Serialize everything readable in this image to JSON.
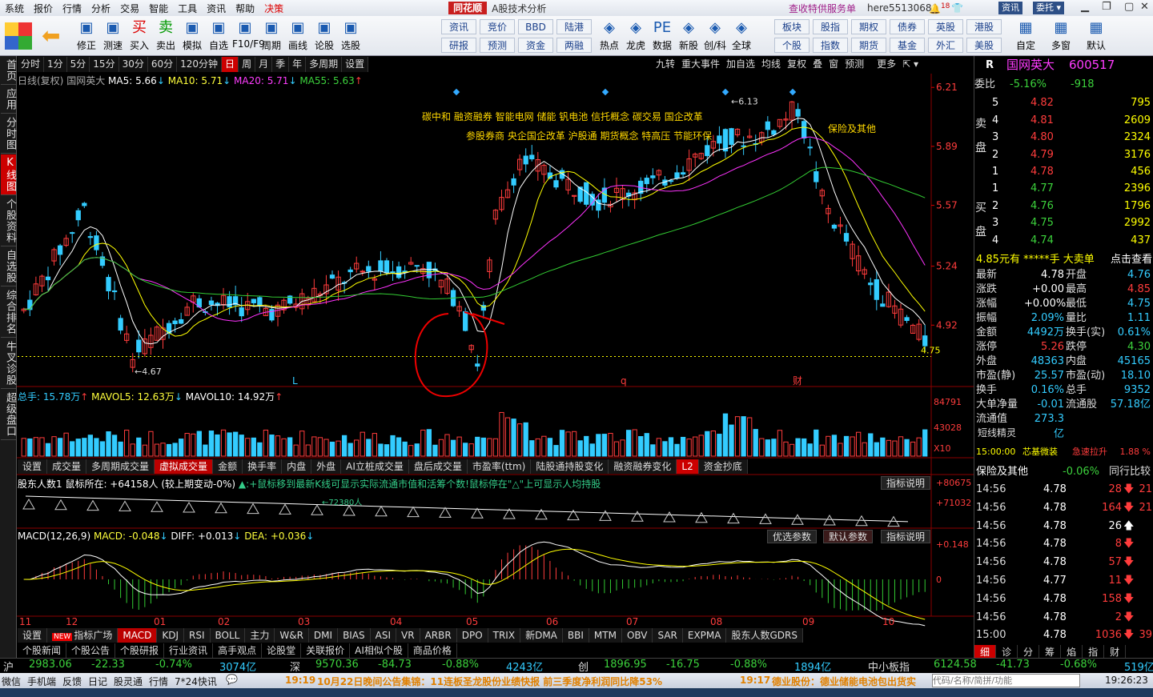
{
  "menubar": {
    "items": [
      "系统",
      "报价",
      "行情",
      "分析",
      "交易",
      "智能",
      "工具",
      "资讯",
      "帮助"
    ],
    "decision": "决策",
    "brand": "同花顺",
    "app_title": "A股技术分析",
    "promo": "查收特供服务单",
    "user": "here5513068",
    "bell_badge": "18",
    "btn_news": "资讯",
    "btn_entrust": "委托"
  },
  "toolbar": {
    "buttons": [
      {
        "label": "修正",
        "icon": "up-down-arrows-icon"
      },
      {
        "label": "测速",
        "icon": "speed-icon"
      },
      {
        "label": "买入",
        "icon": "buy-icon",
        "glyph": "买"
      },
      {
        "label": "卖出",
        "icon": "sell-icon",
        "glyph": "卖"
      },
      {
        "label": "模拟",
        "icon": "hammer-icon"
      },
      {
        "label": "自选",
        "icon": "star-icon"
      },
      {
        "label": "F10/F9",
        "icon": "f10-icon"
      },
      {
        "label": "周期",
        "icon": "clock-icon"
      },
      {
        "label": "画线",
        "icon": "pencil-icon"
      },
      {
        "label": "论股",
        "icon": "comment-icon"
      },
      {
        "label": "选股",
        "icon": "magnifier-icon"
      }
    ],
    "grid": [
      [
        "资讯",
        "竞价",
        "BBD",
        "陆港"
      ],
      [
        "研报",
        "预测",
        "资金",
        "两融"
      ]
    ],
    "buttons2": [
      {
        "label": "热点",
        "icon": "fire-icon"
      },
      {
        "label": "龙虎",
        "icon": "tiger-icon"
      },
      {
        "label": "数据",
        "icon": "pe-icon",
        "glyph": "PE"
      },
      {
        "label": "新股",
        "icon": "building-icon"
      },
      {
        "label": "创/科",
        "icon": "chuang-icon"
      },
      {
        "label": "全球",
        "icon": "globe-icon"
      }
    ],
    "grid2": [
      [
        "板块",
        "股指",
        "期权",
        "债券",
        "英股",
        "港股"
      ],
      [
        "个股",
        "指数",
        "期货",
        "基金",
        "外汇",
        "美股"
      ]
    ],
    "buttons3": [
      {
        "label": "自定",
        "icon": "custom-icon"
      },
      {
        "label": "多窗",
        "icon": "windows-icon"
      },
      {
        "label": "默认",
        "icon": "home-icon"
      }
    ]
  },
  "left_tabs": [
    {
      "label": "首页",
      "sel": false
    },
    {
      "label": "应用",
      "sel": false
    },
    {
      "label": "分时图",
      "sel": false
    },
    {
      "label": "K线图",
      "sel": true
    },
    {
      "label": "个股资料",
      "sel": false
    },
    {
      "label": "自选股",
      "sel": false
    },
    {
      "label": "综合排名",
      "sel": false
    },
    {
      "label": "牛叉诊股",
      "sel": false
    },
    {
      "label": "超级盘口",
      "sel": false
    }
  ],
  "period_tabs": [
    {
      "label": "分时"
    },
    {
      "label": "1分"
    },
    {
      "label": "5分"
    },
    {
      "label": "15分"
    },
    {
      "label": "30分"
    },
    {
      "label": "60分"
    },
    {
      "label": "120分钟"
    },
    {
      "label": "日",
      "sel": true
    },
    {
      "label": "周"
    },
    {
      "label": "月"
    },
    {
      "label": "季"
    },
    {
      "label": "年"
    },
    {
      "label": "多周期"
    },
    {
      "label": "设置"
    }
  ],
  "right_tabs": [
    "九转",
    "重大事件",
    "加自选",
    "均线",
    "复权",
    "叠",
    "窗",
    "预测",
    "",
    "更多"
  ],
  "ma_line": {
    "prefix": "日线(复权)",
    "name": "国网英大",
    "ma5": "MA5: 5.66",
    "ma10": "MA10: 5.71",
    "ma20": "MA20: 5.71",
    "ma55": "MA55: 5.63"
  },
  "chart_data": {
    "type": "candlestick",
    "title": "日线(复权) 国网英大",
    "ylim": [
      4.6,
      6.25
    ],
    "y_ticks": [
      "6.21",
      "5.89",
      "5.57",
      "5.24",
      "4.92"
    ],
    "x_ticks": [
      "11",
      "12",
      "01",
      "02",
      "03",
      "04",
      "05",
      "06",
      "07",
      "08",
      "09",
      "10"
    ],
    "high": "6.13",
    "low": "4.67",
    "last": "4.75",
    "concepts_row1": "碳中和 融资融券 智能电网 储能 钒电池 信托概念 碳交易 国企改革",
    "concepts_row2": "参股券商 央企国企改革 沪股通 期货概念 特高压 节能环保",
    "insurance": "保险及其他",
    "markers": [
      {
        "label": "L"
      },
      {
        "label": "q"
      },
      {
        "label": "财"
      }
    ]
  },
  "volume": {
    "header_total": "总手: 15.78万",
    "mavol5": "MAVOL5: 12.63万",
    "mavol10": "MAVOL10: 14.92万",
    "y_ticks": [
      "84791",
      "43028",
      "X10"
    ]
  },
  "vol_tabs": [
    {
      "label": "设置"
    },
    {
      "label": "成交量"
    },
    {
      "label": "多周期成交量"
    },
    {
      "label": "虚拟成交量",
      "sel": true
    },
    {
      "label": "金额"
    },
    {
      "label": "换手率"
    },
    {
      "label": "内盘"
    },
    {
      "label": "外盘"
    },
    {
      "label": "AI立桩成交量"
    },
    {
      "label": "盘后成交量"
    },
    {
      "label": "市盈率(ttm)"
    },
    {
      "label": "陆股通持股变化"
    },
    {
      "label": "融资融券变化"
    },
    {
      "label": "L2",
      "badge": true
    },
    {
      "label": "资金抄底"
    }
  ],
  "holders": {
    "header": "股东人数1 鼠标所在: +64158人 (较上期变动-0%)",
    "hint": "▲:+鼠标移到最新K线可显示实际流通市值和活筹个数!鼠标停在\"△\"上可显示人均持股",
    "help": "指标说明",
    "y1": "+80675",
    "y2": "+71032",
    "mid_label": "←72380人"
  },
  "macd": {
    "header": "MACD(12,26,9)",
    "macd": "MACD: -0.048",
    "diff": "DIFF: +0.013",
    "dea": "DEA: +0.036",
    "btn1": "优选参数",
    "btn2": "默认参数",
    "btn3": "指标说明",
    "y1": "+0.148",
    "y0": "0"
  },
  "ind_tabs": [
    {
      "label": "设置"
    },
    {
      "label": "指标广场",
      "new": true
    },
    {
      "label": "MACD",
      "sel": true
    },
    {
      "label": "KDJ"
    },
    {
      "label": "RSI"
    },
    {
      "label": "BOLL"
    },
    {
      "label": "主力"
    },
    {
      "label": "W&R"
    },
    {
      "label": "DMI"
    },
    {
      "label": "BIAS"
    },
    {
      "label": "ASI"
    },
    {
      "label": "VR"
    },
    {
      "label": "ARBR"
    },
    {
      "label": "DPO"
    },
    {
      "label": "TRIX"
    },
    {
      "label": "新DMA"
    },
    {
      "label": "BBI"
    },
    {
      "label": "MTM"
    },
    {
      "label": "OBV"
    },
    {
      "label": "SAR"
    },
    {
      "label": "EXPMA"
    },
    {
      "label": "股东人数GDRS"
    }
  ],
  "news_tabs": [
    "个股新闻",
    "个股公告",
    "个股研报",
    "行业资讯",
    "高手观点",
    "论股堂",
    "关联报价",
    "AI相似个股",
    "商品价格"
  ],
  "new_badge": "NEW",
  "quote": {
    "R": "R",
    "name": "国网英大",
    "code": "600517",
    "weibi_label": "委比",
    "weibi": "-5.16%",
    "weicha": "-918",
    "sell": [
      [
        "5",
        "4.82",
        "795"
      ],
      [
        "4",
        "4.81",
        "2609"
      ],
      [
        "3",
        "4.80",
        "2324"
      ],
      [
        "2",
        "4.79",
        "3176"
      ],
      [
        "1",
        "4.78",
        "456"
      ]
    ],
    "buy": [
      [
        "1",
        "4.77",
        "2396"
      ],
      [
        "2",
        "4.76",
        "1796"
      ],
      [
        "3",
        "4.75",
        "2992"
      ],
      [
        "4",
        "4.74",
        "437"
      ]
    ],
    "sell_label": "卖盘",
    "buy_label": "买盘",
    "big_order": "4.85元有 *****手 大卖单",
    "click_view": "点击查看",
    "stats": [
      [
        "最新",
        "4.78",
        "开盘",
        "4.76"
      ],
      [
        "涨跌",
        "+0.00",
        "最高",
        "4.85"
      ],
      [
        "涨幅",
        "+0.00%",
        "最低",
        "4.75"
      ],
      [
        "振幅",
        "2.09%",
        "量比",
        "1.11"
      ],
      [
        "金额",
        "4492万",
        "换手(实)",
        "0.61%"
      ],
      [
        "涨停",
        "5.26",
        "跌停",
        "4.30"
      ],
      [
        "外盘",
        "48363",
        "内盘",
        "45165"
      ],
      [
        "市盈(静)",
        "25.57",
        "市盈(动)",
        "18.10"
      ],
      [
        "换手",
        "0.16%",
        "总手",
        "9352"
      ],
      [
        "大单净量",
        "-0.01",
        "流通股",
        "57.18亿"
      ],
      [
        "流通值",
        "273.3亿",
        "",
        ""
      ]
    ],
    "short_title": "短线精灵",
    "short_time": "15:00:00",
    "short_name": "芯基微装",
    "short_event": "急速拉升",
    "short_pct": "1.88 %",
    "industry": "保险及其他",
    "industry_pct": "-0.06%",
    "industry_cmp": "同行比较",
    "ticks": [
      [
        "14:56",
        "4.78",
        "28",
        "down",
        "21"
      ],
      [
        "14:56",
        "4.78",
        "164",
        "down",
        "21"
      ],
      [
        "14:56",
        "4.78",
        "26",
        "up",
        ""
      ],
      [
        "14:56",
        "4.78",
        "8",
        "down",
        ""
      ],
      [
        "14:56",
        "4.78",
        "57",
        "down",
        ""
      ],
      [
        "14:56",
        "4.77",
        "11",
        "down",
        ""
      ],
      [
        "14:56",
        "4.78",
        "158",
        "down",
        ""
      ],
      [
        "14:56",
        "4.78",
        "2",
        "down",
        ""
      ],
      [
        "15:00",
        "4.78",
        "1036",
        "down",
        "39"
      ]
    ],
    "bottom_tabs": [
      "细",
      "诊",
      "分",
      "筹",
      "焰",
      "指",
      "财"
    ]
  },
  "index_bar": [
    {
      "name": "沪",
      "value": "2983.06",
      "chg": "-22.33",
      "pct": "-0.74%",
      "amt": "3074亿"
    },
    {
      "name": "深",
      "value": "9570.36",
      "chg": "-84.73",
      "pct": "-0.88%",
      "amt": "4243亿"
    },
    {
      "name": "创",
      "value": "1896.95",
      "chg": "-16.75",
      "pct": "-0.88%",
      "amt": "1894亿"
    },
    {
      "name": "中小板指",
      "value": "6124.58",
      "chg": "-41.73",
      "pct": "-0.68%",
      "amt": "519亿"
    }
  ],
  "status2": {
    "items": [
      "微信",
      "手机端",
      "反馈",
      "日记",
      "股灵通",
      "行情",
      "7*24快讯"
    ],
    "news1_time": "19:19",
    "news1": "10月22日晚间公告集锦：11连板圣龙股份业绩快报 前三季度净利润同比降53%",
    "news2_time": "19:17",
    "news2": "德业股份：德业储能电池包出货实",
    "search_placeholder": "代码/名称/简拼/功能",
    "clock": "19:26:23"
  }
}
